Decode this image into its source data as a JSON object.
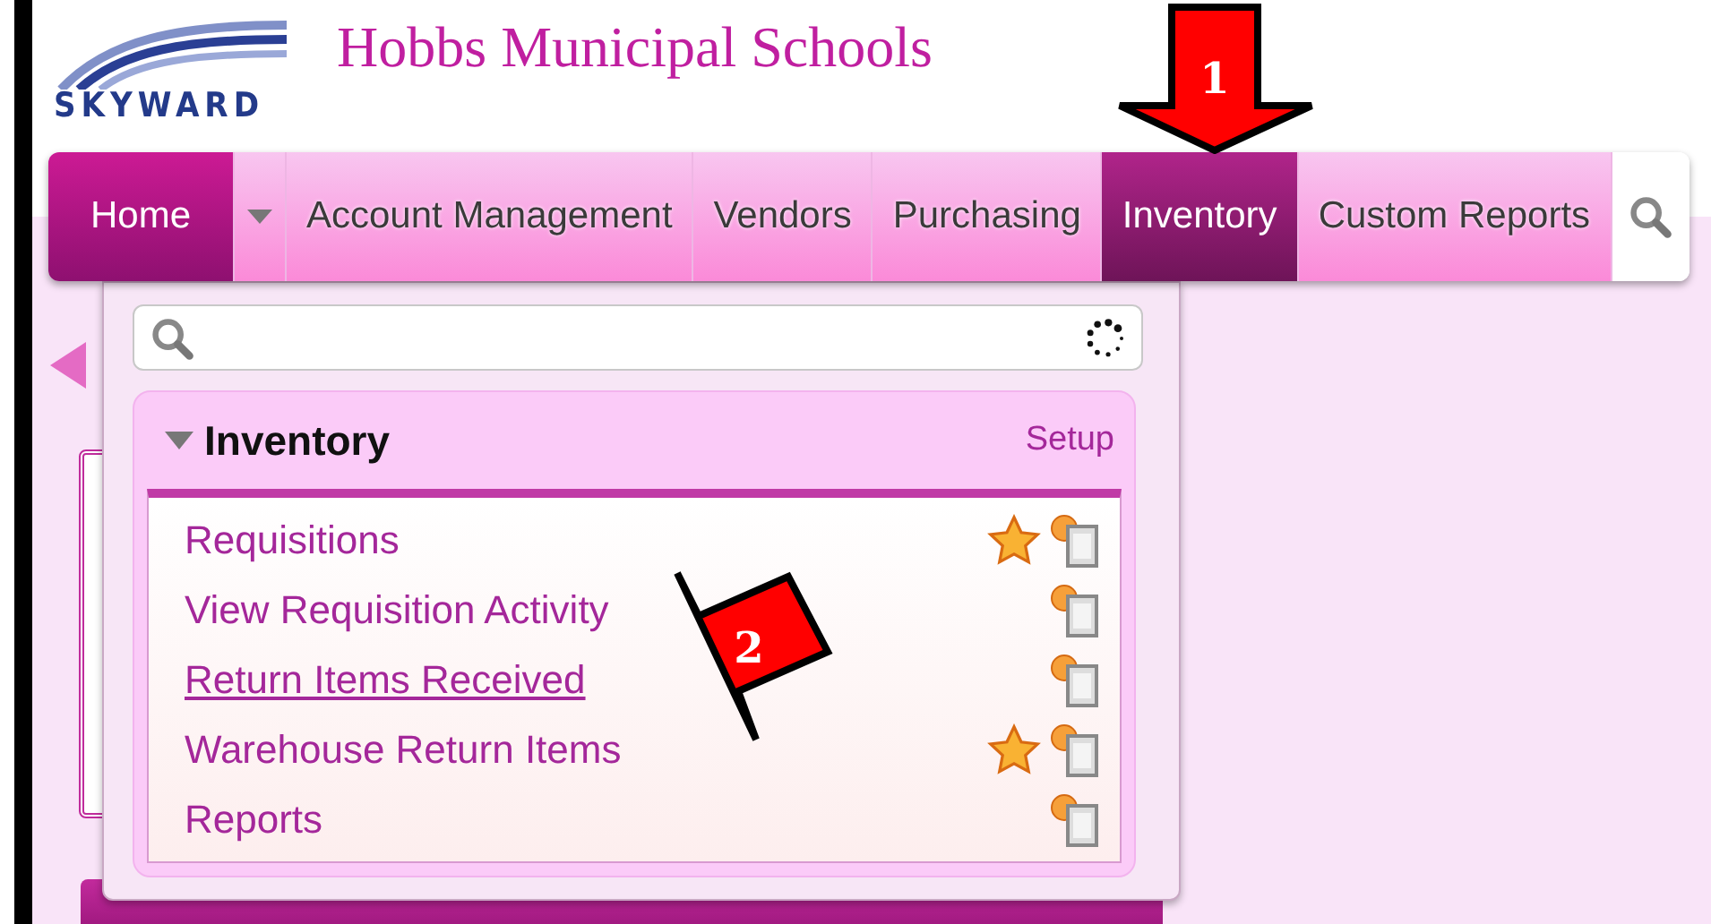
{
  "header": {
    "title": "Hobbs Municipal Schools",
    "logo": "SKYWARD"
  },
  "nav": {
    "tabs": [
      {
        "label": "Home",
        "kind": "home",
        "selected": false
      },
      {
        "label": "Account Management",
        "kind": "tab",
        "selected": false
      },
      {
        "label": "Vendors",
        "kind": "tab",
        "selected": false
      },
      {
        "label": "Purchasing",
        "kind": "tab",
        "selected": false
      },
      {
        "label": "Inventory",
        "kind": "tab",
        "selected": true
      },
      {
        "label": "Custom Reports",
        "kind": "tab",
        "selected": false
      }
    ]
  },
  "menu": {
    "group": {
      "title": "Inventory",
      "expanded": true,
      "setup": "Setup",
      "items": [
        {
          "label": "Requisitions",
          "favorite": true,
          "hovered": false
        },
        {
          "label": "View Requisition Activity",
          "favorite": false,
          "hovered": false
        },
        {
          "label": "Return Items Received",
          "favorite": false,
          "hovered": true
        },
        {
          "label": "Warehouse Return Items",
          "favorite": true,
          "hovered": false
        },
        {
          "label": "Reports",
          "favorite": false,
          "hovered": false
        }
      ]
    }
  },
  "annotations": [
    {
      "label": "1",
      "kind": "down"
    },
    {
      "label": "2",
      "kind": "left"
    }
  ]
}
